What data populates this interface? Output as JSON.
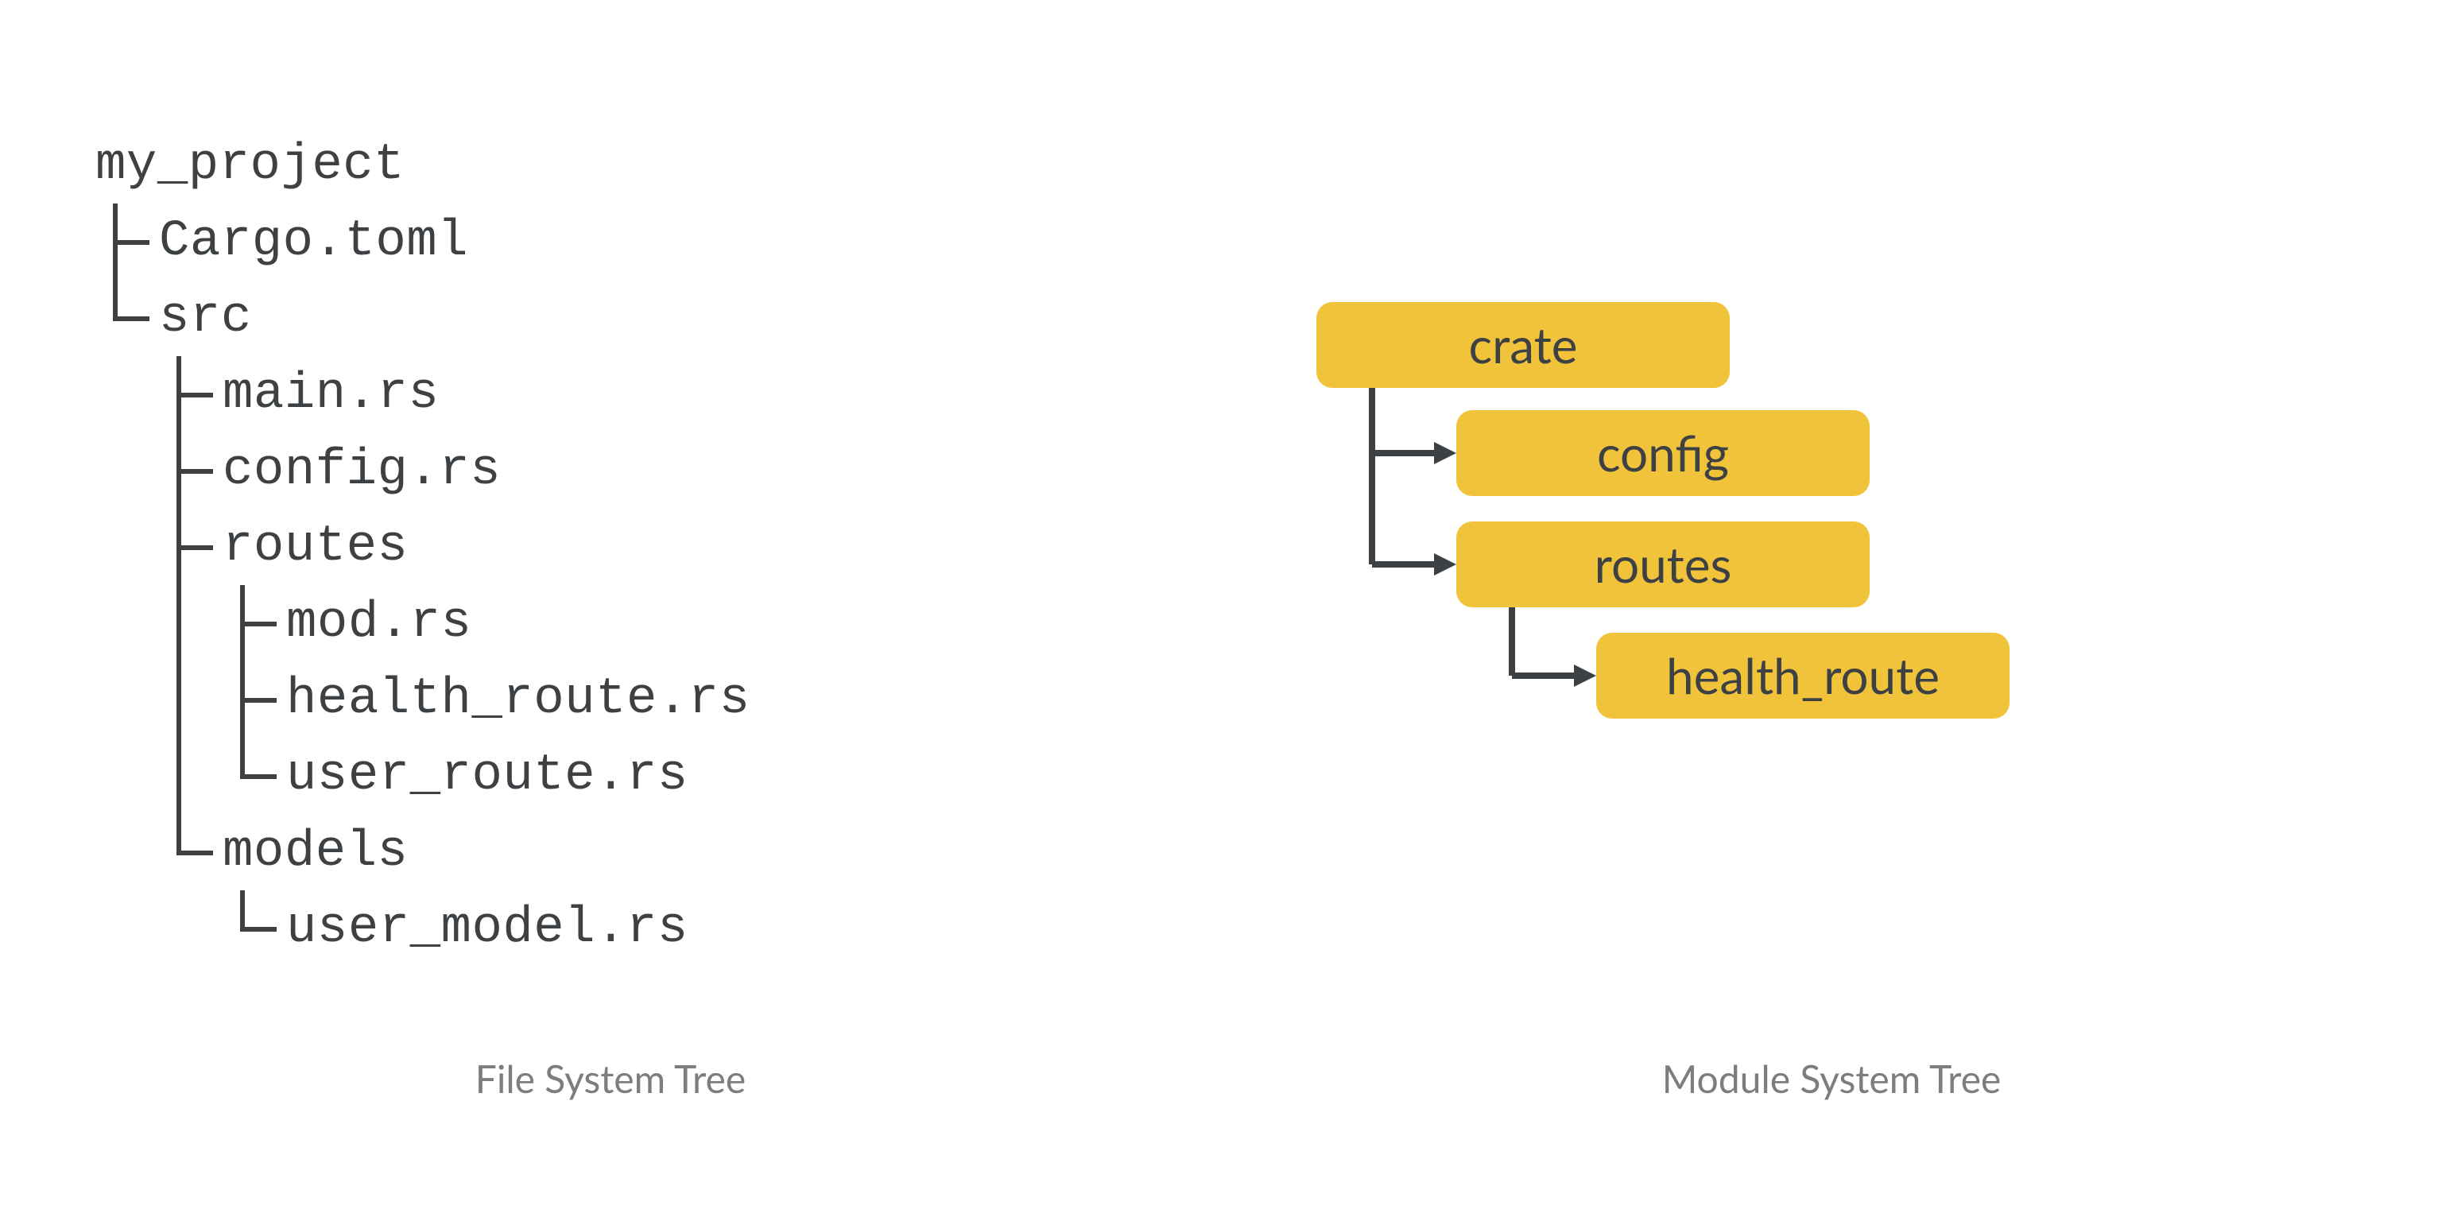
{
  "captions": {
    "filesystem": "File System Tree",
    "modules": "Module System Tree"
  },
  "colors": {
    "box_fill": "#f0c33b",
    "text": "#3d4144",
    "caption": "#7a7e81",
    "line": "#3d4144",
    "background": "#ffffff"
  },
  "filesystem": {
    "root": "my_project",
    "children": [
      {
        "name": "Cargo.toml"
      },
      {
        "name": "src",
        "children": [
          {
            "name": "main.rs"
          },
          {
            "name": "config.rs"
          },
          {
            "name": "routes",
            "children": [
              {
                "name": "mod.rs"
              },
              {
                "name": "health_route.rs"
              },
              {
                "name": "user_route.rs"
              }
            ]
          },
          {
            "name": "models",
            "children": [
              {
                "name": "user_model.rs"
              }
            ]
          }
        ]
      }
    ]
  },
  "modules": {
    "root": "crate",
    "children": [
      {
        "name": "config"
      },
      {
        "name": "routes",
        "children": [
          {
            "name": "health_route"
          }
        ]
      }
    ]
  }
}
